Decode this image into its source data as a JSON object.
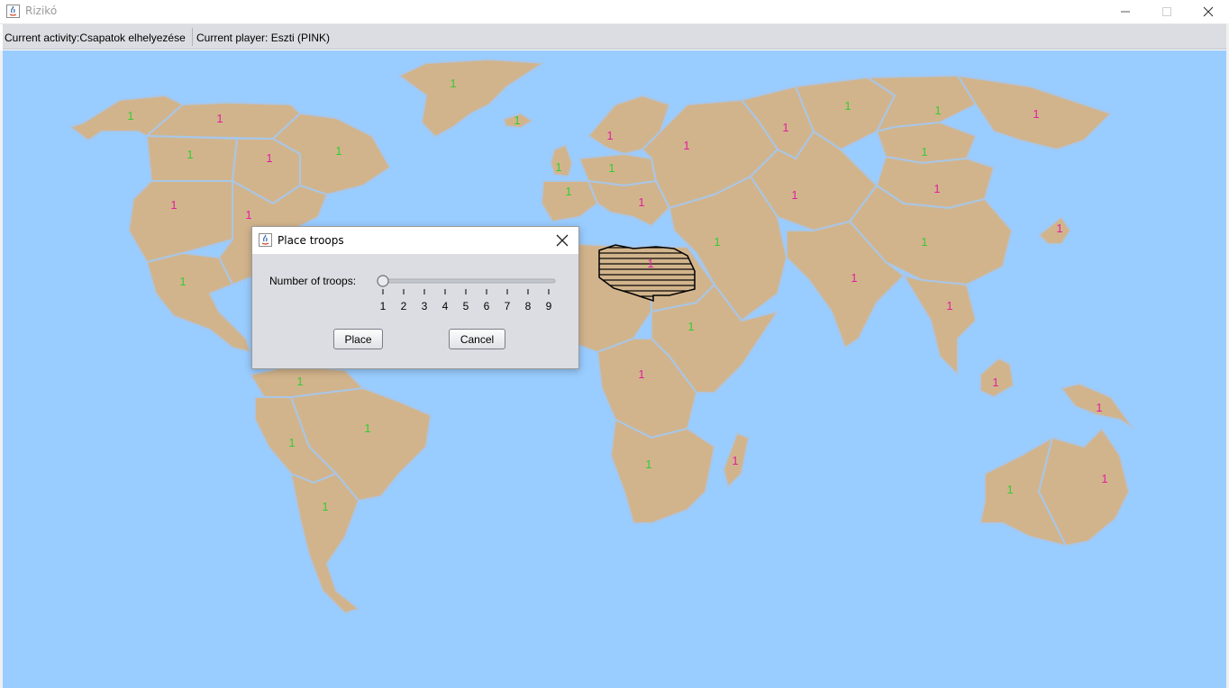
{
  "window": {
    "title": "Rizikó"
  },
  "status": {
    "activity": "Current activity:Csapatok elhelyezése",
    "player": "Current player: Eszti (PINK)"
  },
  "colors": {
    "ocean": "#99ccff",
    "land": "#d2b48c",
    "border": "#a9c6e6",
    "green_player": "#33cc33",
    "pink_player": "#e020a0",
    "selected_hatch": "#000000"
  },
  "territory_troops": {
    "alaska": "1",
    "northwest_territory": "1",
    "greenland": "1",
    "alberta": "1",
    "ontario": "1",
    "quebec": "1",
    "western_us": "1",
    "eastern_us": "1",
    "central_america": "1",
    "iceland": "1",
    "great_britain": "1",
    "scandinavia": "1",
    "northern_europe": "1",
    "western_europe": "1",
    "southern_europe": "1",
    "ukraine": "1",
    "ural": "1",
    "siberia": "1",
    "yakutsk": "1",
    "kamchatka": "1",
    "irkutsk": "1",
    "mongolia": "1",
    "afghanistan": "1",
    "middle_east": "1",
    "china": "1",
    "india": "1",
    "siam": "1",
    "japan": "1",
    "north_africa": "1",
    "egypt": "1",
    "east_africa": "1",
    "congo": "1",
    "south_africa": "1",
    "madagascar": "1",
    "venezuela": "1",
    "peru": "1",
    "brazil": "1",
    "argentina": "1",
    "indonesia": "1",
    "new_guinea": "1",
    "western_australia": "1",
    "eastern_australia": "1"
  },
  "dialog": {
    "title": "Place troops",
    "label": "Number of troops:",
    "slider": {
      "min": 1,
      "max": 9,
      "value": 1,
      "ticks": [
        "1",
        "2",
        "3",
        "4",
        "5",
        "6",
        "7",
        "8",
        "9"
      ]
    },
    "place_label": "Place",
    "cancel_label": "Cancel"
  }
}
